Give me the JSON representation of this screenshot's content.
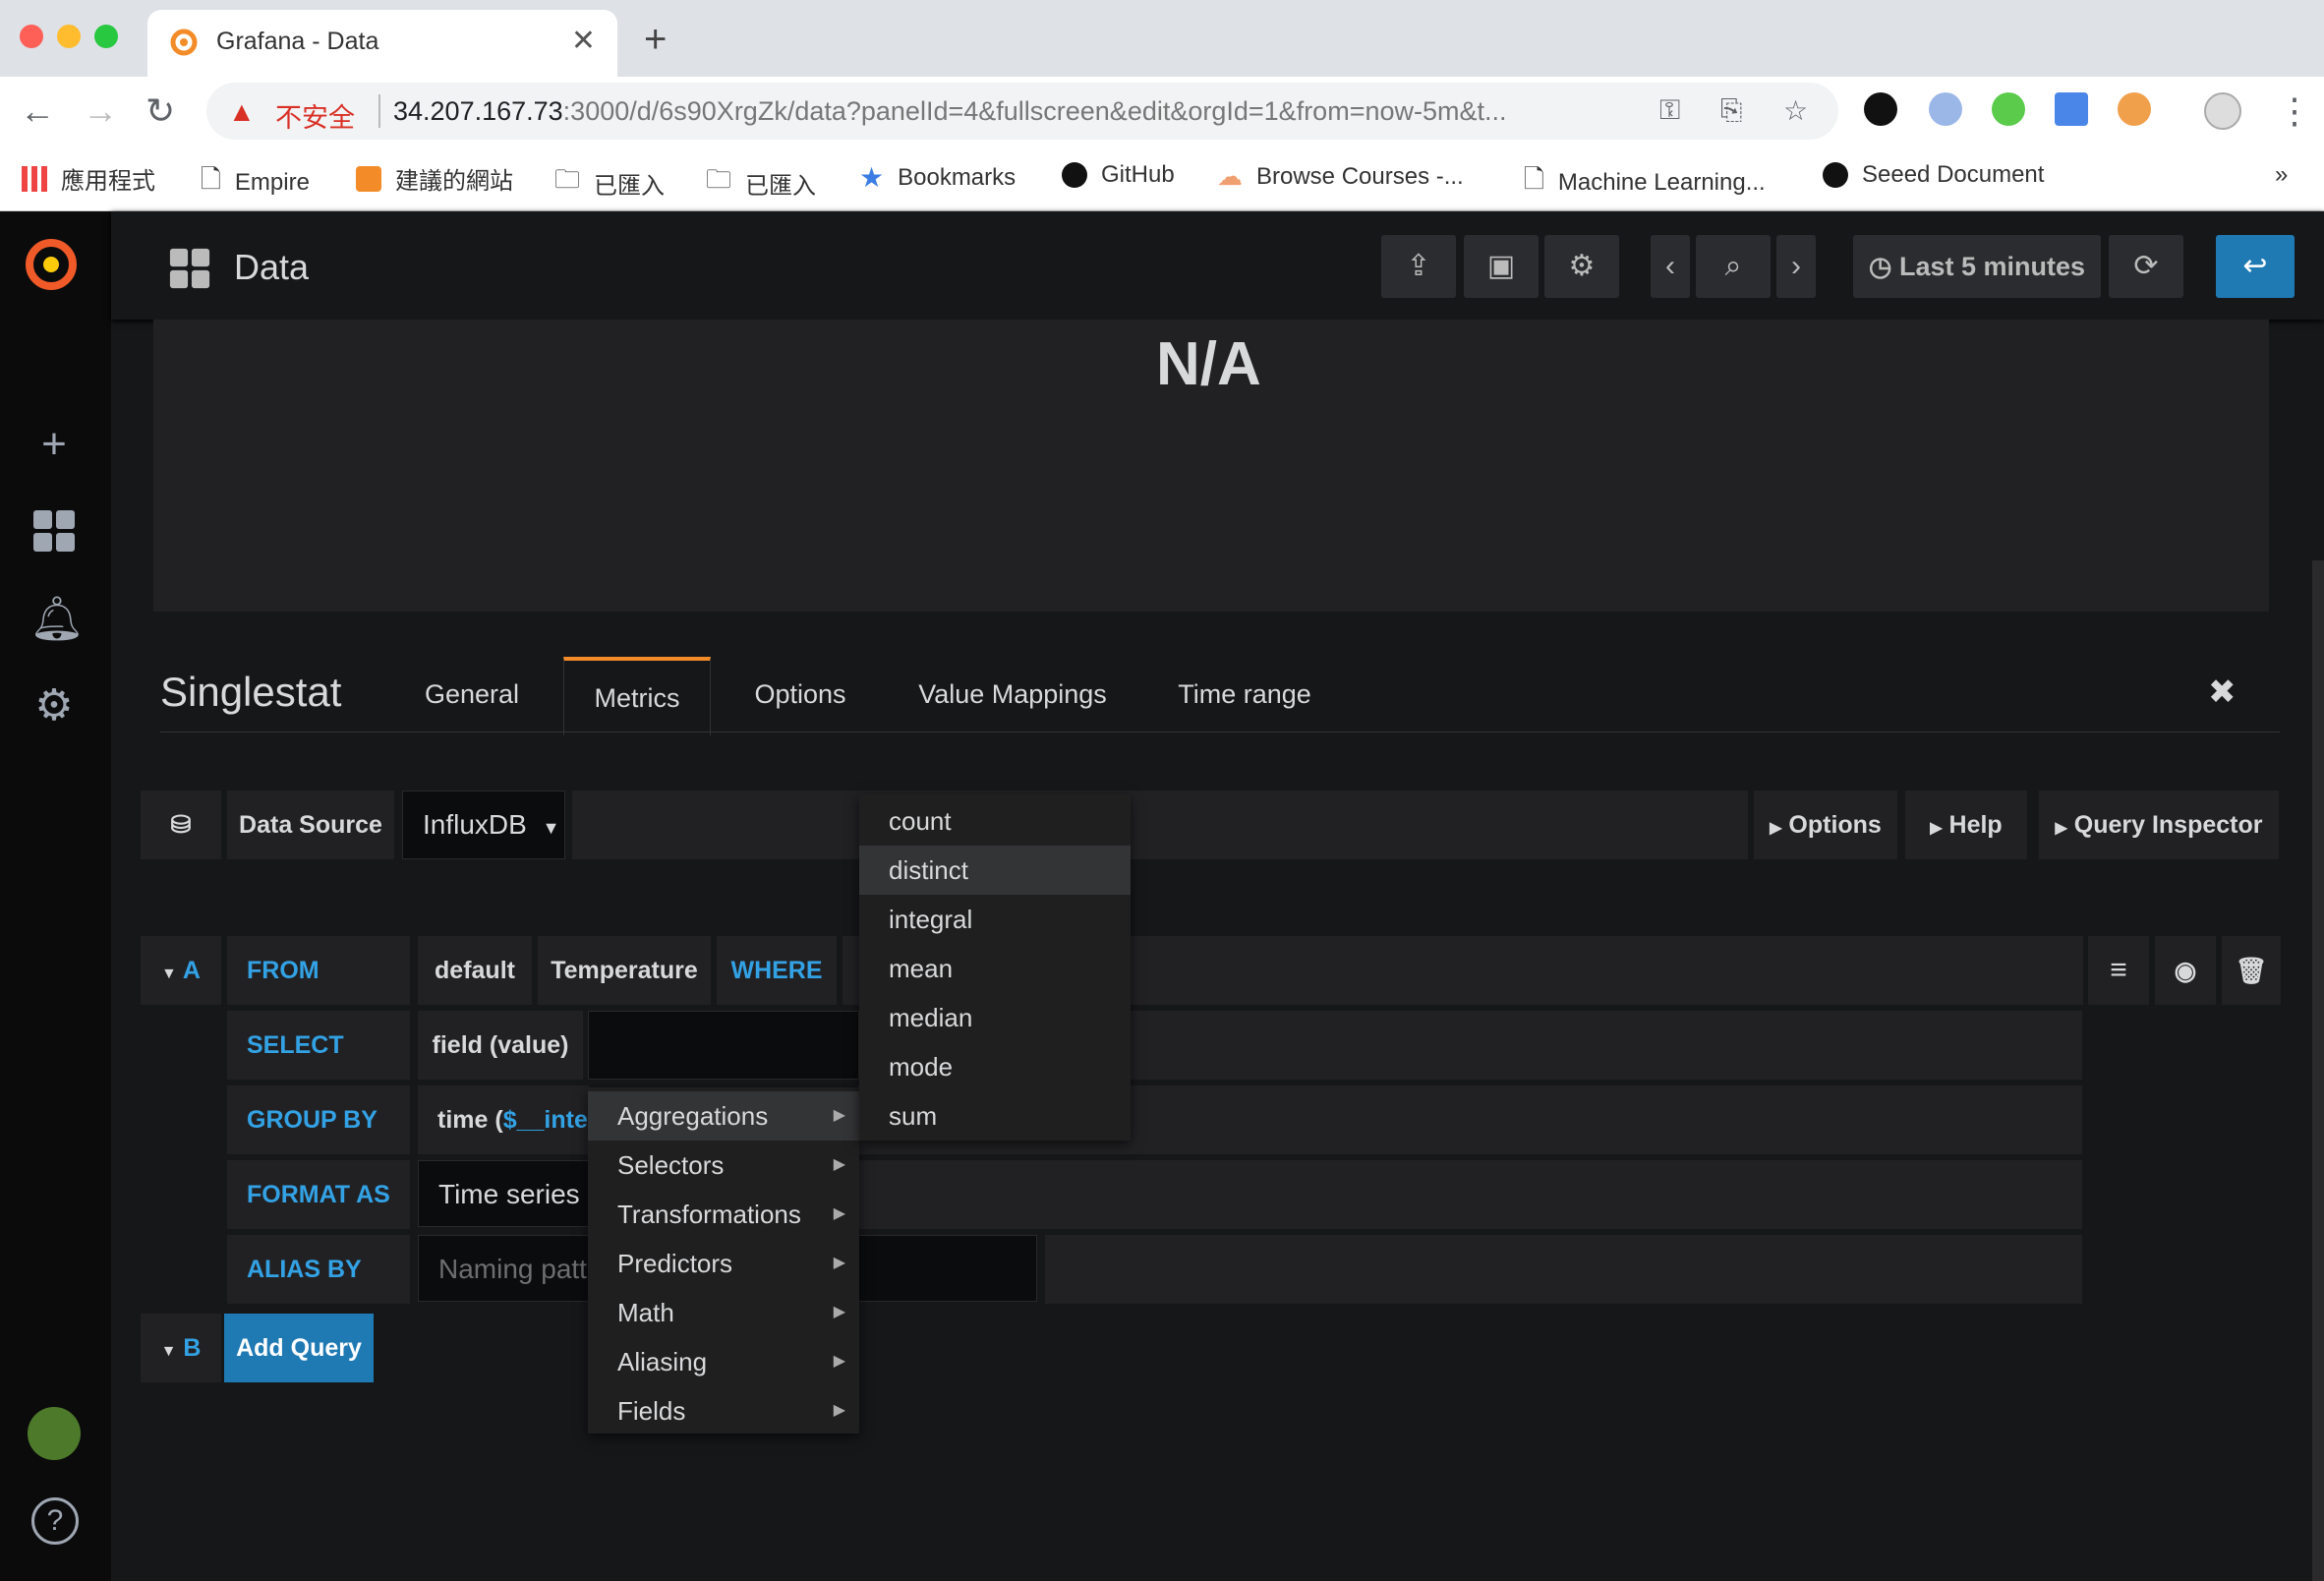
{
  "browser": {
    "tab_title": "Grafana - Data",
    "insecure_label": "不安全",
    "url_host": "34.207.167.73",
    "url_rest": ":3000/d/6s90XrgZk/data?panelId=4&fullscreen&edit&orgId=1&from=now-5m&t...",
    "bookmarks": [
      "應用程式",
      "Empire",
      "建議的網站",
      "已匯入",
      "已匯入",
      "Bookmarks",
      "GitHub",
      "Browse Courses -...",
      "Machine Learning...",
      "Seeed Document"
    ]
  },
  "dashboard": {
    "title": "Data",
    "time_range": "Last 5 minutes"
  },
  "panel": {
    "value": "N/A"
  },
  "editor": {
    "panel_type": "Singlestat",
    "tabs": [
      "General",
      "Metrics",
      "Options",
      "Value Mappings",
      "Time range"
    ],
    "active_tab": "Metrics"
  },
  "datasource": {
    "label": "Data Source",
    "value": "InfluxDB",
    "options_btn": "Options",
    "help_btn": "Help",
    "inspector_btn": "Query Inspector"
  },
  "query": {
    "ref_a": "A",
    "ref_b": "B",
    "from_kw": "FROM",
    "policy": "default",
    "measurement": "Temperature",
    "where_kw": "WHERE",
    "select_kw": "SELECT",
    "select_field": "field (value)",
    "groupby_kw": "GROUP BY",
    "groupby_prefix": "time (",
    "groupby_var": "$__inter",
    "formatas_kw": "FORMAT AS",
    "format_value": "Time series",
    "aliasby_kw": "ALIAS BY",
    "alias_placeholder": "Naming patt",
    "add_query": "Add Query"
  },
  "menu": {
    "categories": [
      "Aggregations",
      "Selectors",
      "Transformations",
      "Predictors",
      "Math",
      "Aliasing",
      "Fields"
    ],
    "aggregations": [
      "count",
      "distinct",
      "integral",
      "mean",
      "median",
      "mode",
      "sum"
    ],
    "highlighted": "distinct"
  },
  "colors": {
    "accent": "#33a2e5",
    "tab_highlight": "#f38c28",
    "primary_button": "#1f7ab4"
  }
}
